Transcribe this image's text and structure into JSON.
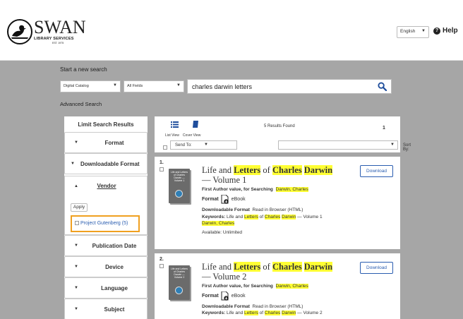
{
  "header": {
    "logo_word": "SWAN",
    "logo_sub": "LIBRARY SERVICES",
    "logo_est": "EST. 1975",
    "language": "English",
    "help_label": "Help"
  },
  "search": {
    "start_label": "Start a new search",
    "catalog_select": "Digital Catalog",
    "field_select": "All Fields",
    "query": "charles darwin letters",
    "advanced_label": "Advanced Search"
  },
  "limit": {
    "title": "Limit Search Results",
    "facets": {
      "format": "Format",
      "downloadable_format": "Downloadable Format",
      "vendor": "Vendor",
      "publication_date": "Publication Date",
      "device": "Device",
      "language": "Language",
      "subject": "Subject"
    },
    "apply_label": "Apply",
    "vendor_option": "Project Gutenberg",
    "vendor_count": "(5)"
  },
  "results_bar": {
    "list_view": "List View",
    "cover_view": "Cover View",
    "results_found": "5 Results Found",
    "page": "1",
    "send_to": "Send To:",
    "sort_by": "Sort By:"
  },
  "results": [
    {
      "num": "1.",
      "cover_text": "Life and Letters of Charles Darwin — Volume 1",
      "title_pre": "Life and ",
      "title_hl1": "Letters",
      "title_mid": " of ",
      "title_hl2": "Charles",
      "title_hl3": "Darwin",
      "title_post": " — Volume 1",
      "author_label": "First Author value, for Searching",
      "author_hl": "Darwin, Charles",
      "format_label": "Format",
      "format_value": "eBook",
      "dl_label": "Downloadable Format",
      "dl_value": "Read in Browser (HTML)",
      "kw_label": "Keywords:",
      "kw_pre": "Life and ",
      "kw_hl1": "Letters",
      "kw_mid": " of ",
      "kw_hl2": "Charles",
      "kw_hl3": "Darwin",
      "kw_post": " — Volume 1",
      "kw_hl4": "Darwin, Charles",
      "availability": "Available: Unlimited",
      "download_label": "Download"
    },
    {
      "num": "2.",
      "cover_text": "Life and Letters of Charles Darwin — Volume 2",
      "title_pre": "Life and ",
      "title_hl1": "Letters",
      "title_mid": " of ",
      "title_hl2": "Charles",
      "title_hl3": "Darwin",
      "title_post": " — Volume 2",
      "author_label": "First Author value, for Searching",
      "author_hl": "Darwin, Charles",
      "format_label": "Format",
      "format_value": "eBook",
      "dl_label": "Downloadable Format",
      "dl_value": "Read in Browser (HTML)",
      "kw_label": "Keywords:",
      "kw_pre": "Life and ",
      "kw_hl1": "Letters",
      "kw_mid": " of ",
      "kw_hl2": "Charles",
      "kw_hl3": "Darwin",
      "kw_post": " — Volume 2",
      "download_label": "Download"
    }
  ]
}
